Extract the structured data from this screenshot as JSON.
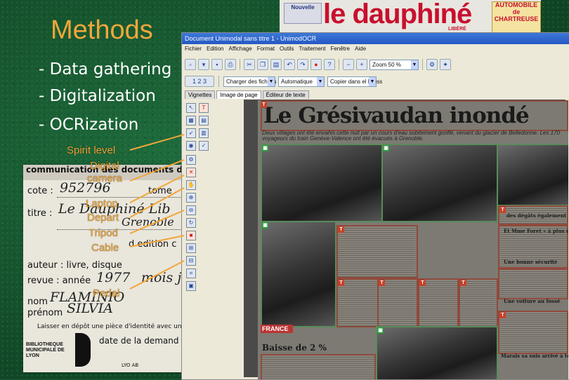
{
  "slide": {
    "title": "Methods",
    "bullets": [
      "- Data gathering",
      "- Digitalization",
      "- OCRization"
    ],
    "equipment_labels": [
      "Spirit level",
      "Digital camera",
      "Laptop",
      "Depart",
      "Tripod",
      "Cable",
      "Pedal"
    ]
  },
  "form_card": {
    "header": "communication des documents de",
    "cote_label": "cote :",
    "cote_value": "952796",
    "titre_label": "titre :",
    "titre_value": "Le Dauphiné Lib",
    "titre_value2": "Grenoble",
    "titre_suffix": "tome",
    "edition_label": "d edition c",
    "auteur_label": "auteur : livre, disque",
    "revue_label": "revue : année",
    "revue_value": "1977",
    "revue_suffix": "mois ju",
    "nom_label": "nom",
    "nom_value": "FLAMINIO",
    "prenom_label": "prénom",
    "prenom_value": "SILVIA",
    "footer": "Laisser en dépôt une pièce d'identité avec une photo",
    "demande": "date de la demand",
    "library": "BIBLIOTHEQUE MUNICIPALE DE LYON",
    "logo_letter": "B",
    "ref": "LYO AB"
  },
  "newspaper_header": {
    "logo": "le dauphiné",
    "libere": "LIBÉRÉ",
    "small_logo": "Nouvelle",
    "ad_title": "AUTOMOBILE de CHARTREUSE"
  },
  "app": {
    "window_title": "Document Unimodal sans titre 1 - UnimodOCR",
    "menu": [
      "Fichier",
      "Edition",
      "Affichage",
      "Format",
      "Outils",
      "Traitement",
      "Fenêtre",
      "Aide"
    ],
    "zoom": "Zoom 50 %",
    "page_selector": "1 2 3",
    "load_files": "Charger des fichiers",
    "mode": "Automatique",
    "save_mode": "Copier dans el Press",
    "tabs": [
      "Vignettes",
      "Image de page",
      "Éditeur de texte"
    ],
    "active_tab": 1
  },
  "document": {
    "headline": "Le Grésivaudan inondé",
    "subhead": "Deux villages ont été envahis cette nuit par un cours d'eau subitement gonflé, venant du glacier de Belledonne. Les 170 voyageurs du train Genève-Valence ont été évacués à Grenoble.",
    "section": "FRANCE",
    "article_heading": "Baisse de 2 %",
    "side_headings": [
      "des dégâts également la nuit dernière",
      "Et Mme Foret « à plus de cave »",
      "Une bonne sécurité",
      "Une voiture au fossé",
      "Marais sa suis arrivé à temps »"
    ]
  }
}
